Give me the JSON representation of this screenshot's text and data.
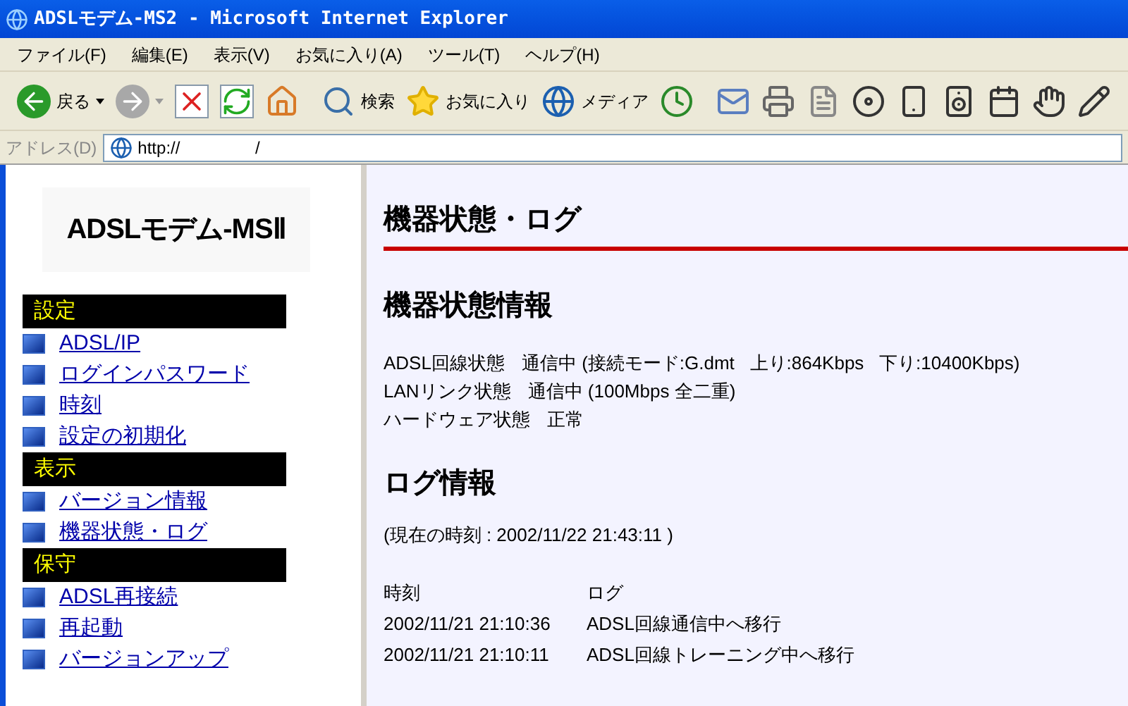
{
  "window": {
    "title": "ADSLモデム-MS2 - Microsoft Internet Explorer"
  },
  "menu": [
    "ファイル(F)",
    "編集(E)",
    "表示(V)",
    "お気に入り(A)",
    "ツール(T)",
    "ヘルプ(H)"
  ],
  "toolbar": {
    "back": "戻る",
    "search": "検索",
    "favorites": "お気に入り",
    "media": "メディア"
  },
  "address": {
    "label": "アドレス(D)",
    "value": "http://                /"
  },
  "sidebar": {
    "logo": "ADSLモデム-MSⅡ",
    "sections": [
      {
        "title": "設定",
        "items": [
          "ADSL/IP",
          "ログインパスワード",
          "時刻",
          "設定の初期化"
        ]
      },
      {
        "title": "表示",
        "items": [
          "バージョン情報",
          "機器状態・ログ"
        ]
      },
      {
        "title": "保守",
        "items": [
          "ADSL再接続",
          "再起動",
          "バージョンアップ"
        ]
      }
    ]
  },
  "main": {
    "title": "機器状態・ログ",
    "status_heading": "機器状態情報",
    "status": [
      {
        "label": "ADSL回線状態",
        "value": "通信中 (接続モード:G.dmt   上り:864Kbps   下り:10400Kbps)"
      },
      {
        "label": "LANリンク状態",
        "value": "通信中 (100Mbps 全二重)"
      },
      {
        "label": "ハードウェア状態",
        "value": "正常"
      }
    ],
    "log_heading": "ログ情報",
    "current_time": "(現在の時刻 : 2002/11/22 21:43:11 )",
    "log_columns": [
      "時刻",
      "ログ"
    ],
    "log_rows": [
      {
        "time": "2002/11/21 21:10:36",
        "message": "ADSL回線通信中へ移行"
      },
      {
        "time": "2002/11/21 21:10:11",
        "message": "ADSL回線トレーニング中へ移行"
      }
    ]
  }
}
